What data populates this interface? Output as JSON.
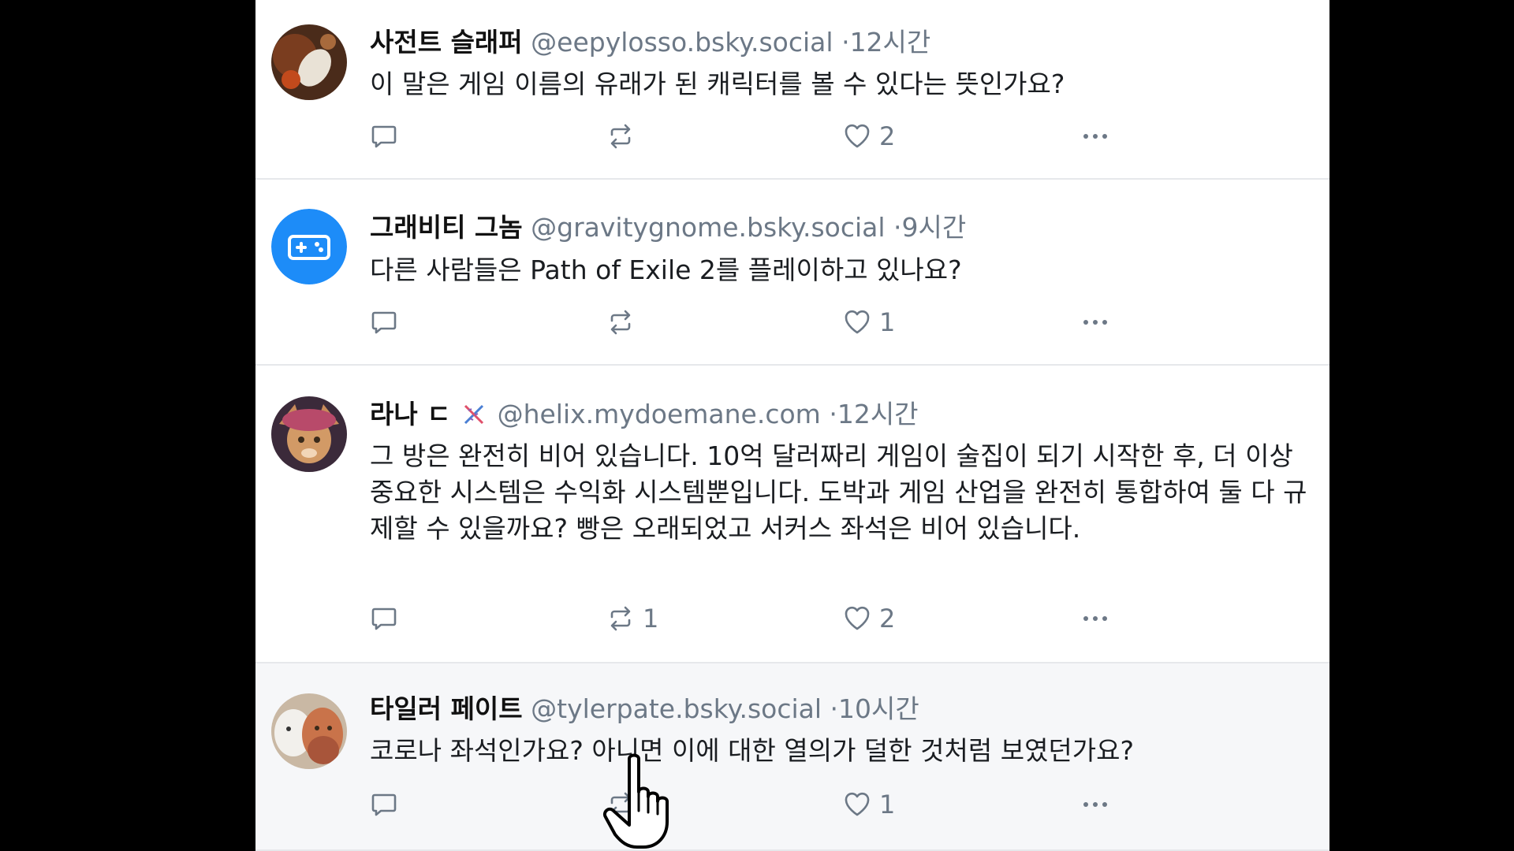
{
  "colors": {
    "background": "#000000",
    "feed": "#ffffff",
    "text": "#1a1d21",
    "muted": "#6c7886",
    "divider": "#e6e8eb",
    "avatar_blue": "#1d8cf8"
  },
  "posts": [
    {
      "name": "사전트 슬래퍼",
      "handle": "@eepylosso.bsky.social",
      "sep": "·",
      "time": "12시간",
      "text": "이 말은 게임 이름의 유래가 된 캐릭터를 볼 수 있다는 뜻인가요?",
      "reply_count": "",
      "repost_count": "",
      "like_count": "2",
      "avatar_icon": "photo-avatar-icon"
    },
    {
      "name": "그래비티 그놈",
      "handle": "@gravitygnome.bsky.social",
      "sep": "·",
      "time": "9시간",
      "text": "다른 사람들은 Path of Exile 2를 플레이하고 있나요?",
      "reply_count": "",
      "repost_count": "",
      "like_count": "1",
      "avatar_icon": "gamepad-icon"
    },
    {
      "name": "라나 ㄷ",
      "handle": "@helix.mydoemane.com",
      "sep": "·",
      "time": "12시간",
      "text": "그 방은 완전히 비어 있습니다. 10억 달러짜리 게임이 술집이 되기 시작한 후, 더 이상 중요한 시스템은 수익화 시스템뿐입니다. 도박과 게임 산업을 완전히 통합하여 둘 다 규제할 수 있을까요? 빵은 오래되었고 서커스 좌석은 비어 있습니다.",
      "reply_count": "",
      "repost_count": "1",
      "like_count": "2",
      "avatar_icon": "photo-avatar-icon"
    },
    {
      "name": "타일러 페이트",
      "handle": "@tylerpate.bsky.social",
      "sep": "·",
      "time": "10시간",
      "text": "코로나 좌석인가요? 아니면 이에 대한 열의가 덜한 것처럼 보였던가요?",
      "reply_count": "",
      "repost_count": "",
      "like_count": "1",
      "avatar_icon": "photo-avatar-icon"
    }
  ]
}
